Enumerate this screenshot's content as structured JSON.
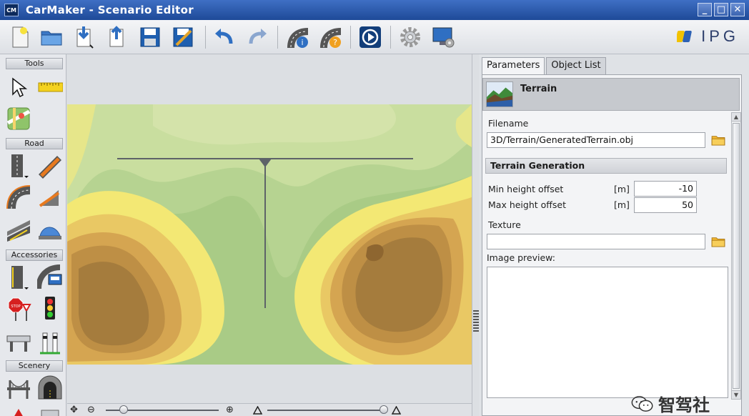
{
  "window": {
    "icon_text": "CM",
    "title": "CarMaker - Scenario Editor",
    "controls": [
      "_",
      "□",
      "✕"
    ]
  },
  "toolbar": {
    "buttons": [
      "new-file",
      "open-folder",
      "import",
      "export",
      "save",
      "save-as",
      "undo",
      "redo",
      "road-info",
      "road-help",
      "play-movie",
      "settings",
      "display-settings"
    ],
    "logo": "IPG"
  },
  "tools_panel": {
    "sections": {
      "tools": "Tools",
      "road": "Road",
      "accessories": "Accessories",
      "scenery": "Scenery"
    }
  },
  "zoombar": {
    "pan_icon": "✥",
    "zoom_out": "⊖",
    "zoom_in": "⊕",
    "zoom_level": 0.16,
    "height_level": 0.97
  },
  "right_panel": {
    "tabs": [
      "Parameters",
      "Object List"
    ],
    "active_tab": "Parameters",
    "object_title": "Terrain",
    "filename_label": "Filename",
    "filename_value": "3D/Terrain/GeneratedTerrain.obj",
    "section_title": "Terrain Generation",
    "min_height_label": "Min height offset",
    "min_height_unit": "[m]",
    "min_height_value": "-10",
    "max_height_label": "Max height offset",
    "max_height_unit": "[m]",
    "max_height_value": "50",
    "texture_label": "Texture",
    "texture_value": "",
    "preview_label": "Image preview:"
  },
  "watermark": "智驾社",
  "colors": {
    "titlebar": "#2a58ab",
    "terrain_light_green": "#c9de9f",
    "terrain_green": "#a9cb86",
    "terrain_yellow": "#f3e874",
    "terrain_brown": "#a57c3d"
  }
}
